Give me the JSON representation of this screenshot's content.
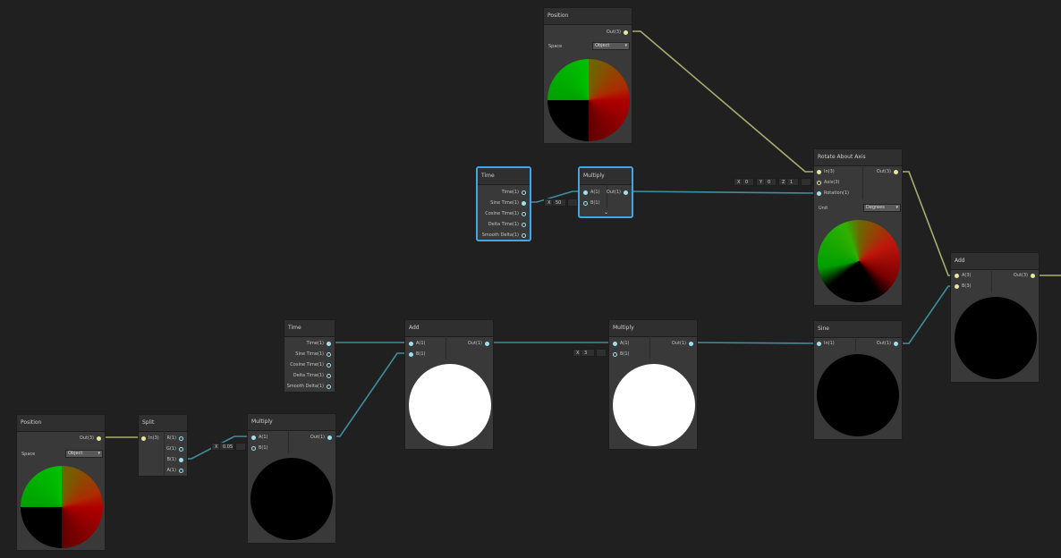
{
  "colors": {
    "canvas": "#202020",
    "node_body": "#393939",
    "node_header": "#2f2f2f",
    "selected_border": "#44a4e4",
    "wire_vec3": "#a8ac6e",
    "wire_float": "#3f8e9e",
    "port_vec3": "#e6e89a",
    "port_float": "#9edff0"
  },
  "nodes": {
    "position_top": {
      "title": "Position",
      "out": "Out(3)",
      "space_label": "Space",
      "space_value": "Object"
    },
    "time_top": {
      "title": "Time",
      "outs": [
        "Time(1)",
        "Sine Time(1)",
        "Cosine Time(1)",
        "Delta Time(1)",
        "Smooth Delta(1)"
      ]
    },
    "multiply_top": {
      "title": "Multiply",
      "in_a": "A(1)",
      "in_b": "B(1)",
      "out": "Out(1)",
      "b_axis": "X",
      "b_value": "50"
    },
    "rotate": {
      "title": "Rotate About Axis",
      "in": "In(3)",
      "axis": "Axis(3)",
      "rotation": "Rotation(1)",
      "out": "Out(3)",
      "unit_label": "Unit",
      "unit_value": "Degrees",
      "axis_x_label": "X",
      "axis_x": "0",
      "axis_y_label": "Y",
      "axis_y": "0",
      "axis_z_label": "Z",
      "axis_z": "1"
    },
    "add_right": {
      "title": "Add",
      "in_a": "A(3)",
      "in_b": "B(3)",
      "out": "Out(3)"
    },
    "time_mid": {
      "title": "Time",
      "outs": [
        "Time(1)",
        "Sine Time(1)",
        "Cosine Time(1)",
        "Delta Time(1)",
        "Smooth Delta(1)"
      ]
    },
    "add_mid": {
      "title": "Add",
      "in_a": "A(1)",
      "in_b": "B(1)",
      "out": "Out(1)"
    },
    "multiply_mid": {
      "title": "Multiply",
      "in_a": "A(1)",
      "in_b": "B(1)",
      "out": "Out(1)",
      "b_axis": "X",
      "b_value": "3"
    },
    "sine": {
      "title": "Sine",
      "in": "In(1)",
      "out": "Out(1)"
    },
    "position_bottom": {
      "title": "Position",
      "out": "Out(3)",
      "space_label": "Space",
      "space_value": "Object"
    },
    "split": {
      "title": "Split",
      "in": "In(3)",
      "outs": [
        "R(1)",
        "G(1)",
        "B(1)",
        "A(1)"
      ]
    },
    "multiply_bottom": {
      "title": "Multiply",
      "in_a": "A(1)",
      "in_b": "B(1)",
      "out": "Out(1)",
      "b_axis": "X",
      "b_value": "0.05"
    }
  }
}
